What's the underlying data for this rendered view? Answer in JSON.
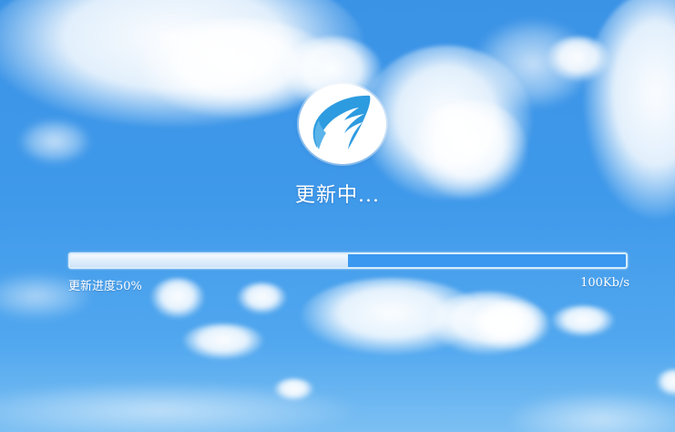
{
  "window": {
    "background": "sky-with-clouds"
  },
  "logo": {
    "icon": "feather-sail-logo-icon",
    "colors": {
      "circle": "#ffffff",
      "mark": "#2d9be0"
    }
  },
  "status": {
    "text": "更新中..."
  },
  "progress": {
    "percent": 50,
    "label": "更新进度50%",
    "speed": "100Kb/s",
    "colors": {
      "track": "#3a98f0",
      "fill": "#e6f2fc",
      "border": "#d8ecfb"
    }
  }
}
